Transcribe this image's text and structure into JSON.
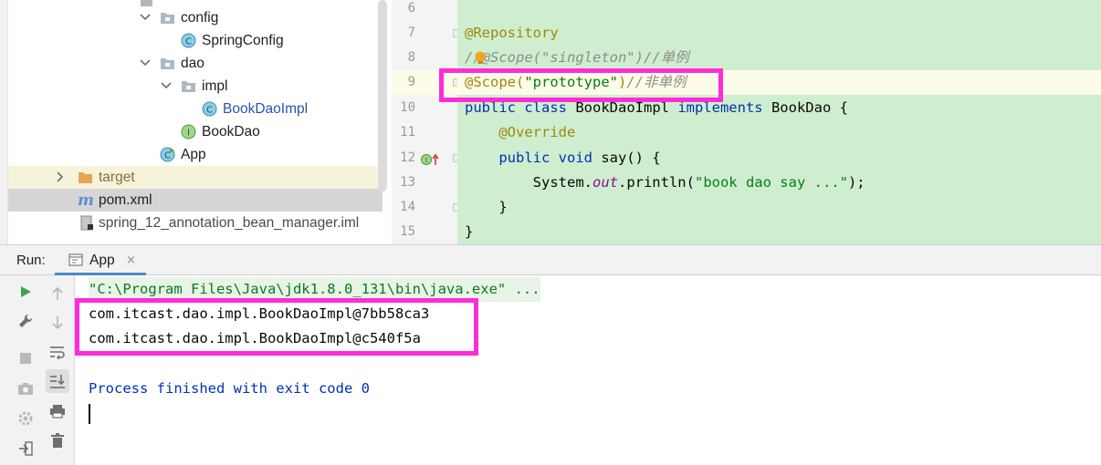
{
  "project_tree": {
    "items": [
      {
        "label": "config",
        "kind": "folder"
      },
      {
        "label": "SpringConfig",
        "kind": "class"
      },
      {
        "label": "dao",
        "kind": "folder"
      },
      {
        "label": "impl",
        "kind": "folder"
      },
      {
        "label": "BookDaoImpl",
        "kind": "class"
      },
      {
        "label": "BookDao",
        "kind": "interface"
      },
      {
        "label": "App",
        "kind": "class-main"
      },
      {
        "label": "target",
        "kind": "excluded-folder"
      },
      {
        "label": "pom.xml",
        "kind": "maven-file"
      },
      {
        "label": "spring_12_annotation_bean_manager.iml",
        "kind": "module-file"
      }
    ]
  },
  "editor": {
    "line_numbers": [
      "6",
      "7",
      "8",
      "9",
      "10",
      "11",
      "12",
      "13",
      "14",
      "15"
    ],
    "lines": [
      {
        "t1": ""
      },
      {
        "t1": "@Repository"
      },
      {
        "t1": "//",
        "t2": "@Scope(\"singleton\")//单例"
      },
      {
        "t1": "@Scope(",
        "t2": "\"prototype\"",
        "t3": ")",
        "t4": "//非单例"
      },
      {
        "t1": "public class ",
        "t2": "BookDaoImpl ",
        "t3": "implements ",
        "t4": "BookDao {"
      },
      {
        "t1": "    @Override"
      },
      {
        "t1": "    public void ",
        "t2": "say() {"
      },
      {
        "t1": "        System.",
        "t2": "out",
        "t3": ".println(",
        "t4": "\"book dao say ...\"",
        "t5": ");"
      },
      {
        "t1": "    }"
      },
      {
        "t1": "}"
      }
    ]
  },
  "run_panel": {
    "label": "Run:",
    "tab_label": "App",
    "tab_close": "×",
    "console": {
      "command": "\"C:\\Program Files\\Java\\jdk1.8.0_131\\bin\\java.exe\" ...",
      "output": [
        "com.itcast.dao.impl.BookDaoImpl@7bb58ca3",
        "com.itcast.dao.impl.BookDaoImpl@c540f5a"
      ],
      "exit_message": "Process finished with exit code 0"
    }
  },
  "colors": {
    "highlight": "#ff2bd8",
    "editor_bg": "#cfeecf",
    "keyword": "#0033b3",
    "string": "#067d17",
    "annotation": "#9e880d"
  }
}
